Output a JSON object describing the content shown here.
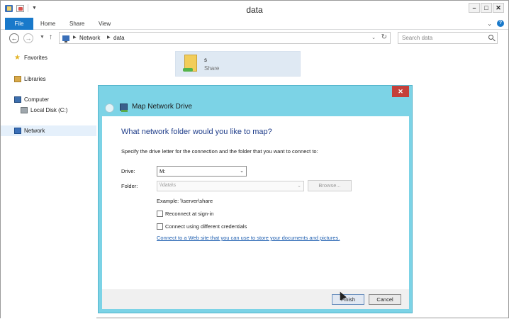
{
  "window": {
    "title": "data"
  },
  "ribbon": {
    "tabs": {
      "file": "File",
      "home": "Home",
      "share": "Share",
      "view": "View"
    }
  },
  "address": {
    "crumbs": [
      "Network",
      "data"
    ]
  },
  "search": {
    "placeholder": "Search data"
  },
  "navpane": {
    "items": [
      {
        "label": "Favorites",
        "icon": "star-icon"
      },
      {
        "label": "Libraries",
        "icon": "library-icon"
      },
      {
        "label": "Computer",
        "icon": "computer-icon"
      },
      {
        "label": "Local Disk (C:)",
        "icon": "disk-icon"
      },
      {
        "label": "Network",
        "icon": "network-icon",
        "selected": true
      }
    ]
  },
  "content": {
    "share": {
      "name": "s",
      "type": "Share"
    }
  },
  "dialog": {
    "title": "Map Network Drive",
    "close": "✕",
    "heading": "What network folder would you like to map?",
    "instruction": "Specify the drive letter for the connection and the folder that you want to connect to:",
    "drive_label": "Drive:",
    "drive_value": "M:",
    "folder_label": "Folder:",
    "folder_value": "\\\\data\\s",
    "browse": "Browse...",
    "example": "Example: \\\\server\\share",
    "reconnect": "Reconnect at sign-in",
    "reconnect_checked": false,
    "credentials": "Connect using different credentials",
    "credentials_checked": false,
    "link": "Connect to a Web site that you can use to store your documents and pictures.",
    "finish": "Finish",
    "cancel": "Cancel"
  },
  "colors": {
    "accent": "#1979ca",
    "dialog_frame": "#7cd3e6",
    "heading": "#1f3d8a",
    "close": "#c5403a"
  }
}
